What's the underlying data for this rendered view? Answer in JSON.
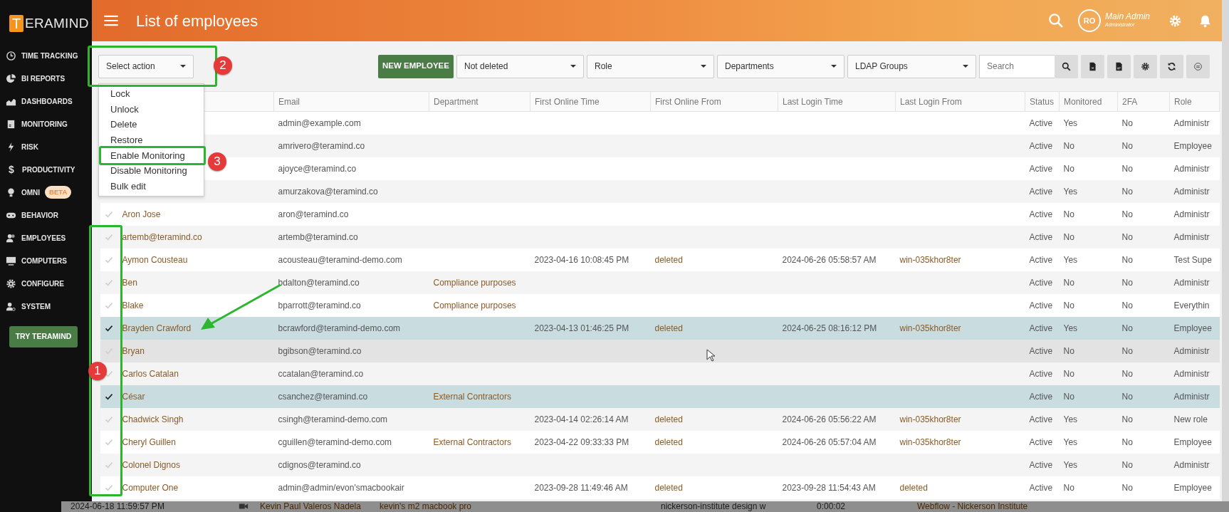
{
  "sidebar": {
    "logo": {
      "mark": "T",
      "text": "ERAMIND"
    },
    "items": [
      {
        "label": "TIME TRACKING"
      },
      {
        "label": "BI REPORTS"
      },
      {
        "label": "DASHBOARDS"
      },
      {
        "label": "MONITORING"
      },
      {
        "label": "RISK"
      },
      {
        "label": "PRODUCTIVITY",
        "glyph": "$"
      },
      {
        "label": "OMNI",
        "badge": "BETA"
      },
      {
        "label": "BEHAVIOR"
      },
      {
        "label": "EMPLOYEES"
      },
      {
        "label": "COMPUTERS"
      },
      {
        "label": "CONFIGURE"
      },
      {
        "label": "SYSTEM"
      }
    ],
    "try_button": "TRY TERAMIND"
  },
  "header": {
    "title": "List of employees",
    "avatar": "RO",
    "user_name": "Main Admin",
    "user_role": "Administrator"
  },
  "toolbar": {
    "action_select": "Select action",
    "new_button": "NEW EMPLOYEE",
    "filters": [
      {
        "label": "Not deleted"
      },
      {
        "label": "Role"
      },
      {
        "label": "Departments"
      },
      {
        "label": "LDAP Groups"
      }
    ],
    "search": {
      "placeholder": "Search"
    }
  },
  "action_menu": {
    "items": [
      {
        "label": "Lock",
        "highlighted": false
      },
      {
        "label": "Unlock",
        "highlighted": false
      },
      {
        "label": "Delete",
        "highlighted": false
      },
      {
        "label": "Restore",
        "highlighted": false
      },
      {
        "label": "Enable Monitoring",
        "highlighted": true
      },
      {
        "label": "Disable Monitoring",
        "highlighted": false
      },
      {
        "label": "Bulk edit",
        "highlighted": false
      }
    ]
  },
  "table": {
    "columns": [
      "Email",
      "Department",
      "First Online Time",
      "First Online From",
      "Last Login Time",
      "Last Login From",
      "Status",
      "Monitored",
      "2FA",
      "Role"
    ],
    "rows": [
      {
        "email": "admin@example.com",
        "status": "Active",
        "monitored": "Yes",
        "twofa": "No",
        "role": "Administr"
      },
      {
        "email": "amrivero@teramind.co",
        "status": "Active",
        "monitored": "No",
        "twofa": "No",
        "role": "Employee"
      },
      {
        "email": "ajoyce@teramind.co",
        "status": "Active",
        "monitored": "No",
        "twofa": "No",
        "role": "Administr"
      },
      {
        "email": "amurzakova@teramind.co",
        "status": "Active",
        "monitored": "Yes",
        "twofa": "No",
        "role": "Administr"
      },
      {
        "checked": false,
        "hovered": false,
        "name": "Aron Jose",
        "email": "aron@teramind.co",
        "status": "Active",
        "monitored": "No",
        "twofa": "No",
        "role": "Administr"
      },
      {
        "checked": false,
        "hovered": false,
        "name": "artemb@teramind.co",
        "email": "artemb@teramind.co",
        "status": "Active",
        "monitored": "No",
        "twofa": "No",
        "role": "Administr"
      },
      {
        "checked": false,
        "hovered": false,
        "name": "Aymon Cousteau",
        "email": "acousteau@teramind-demo.com",
        "first_online_time": "2023-04-16 10:08:45 PM",
        "first_online_from": "deleted",
        "last_login_time": "2024-06-26 05:58:57 AM",
        "last_login_from": "win-035khor8ter",
        "status": "Active",
        "monitored": "Yes",
        "twofa": "No",
        "role": "Test Supe"
      },
      {
        "checked": false,
        "hovered": false,
        "name": "Ben",
        "email": "bdalton@teramind.co",
        "department": "Compliance purposes",
        "status": "Active",
        "monitored": "No",
        "twofa": "No",
        "role": "Administr"
      },
      {
        "checked": false,
        "hovered": false,
        "name": "Blake",
        "email": "bparrott@teramind.co",
        "department": "Compliance purposes",
        "status": "Active",
        "monitored": "No",
        "twofa": "No",
        "role": "Everythin"
      },
      {
        "checked": true,
        "hovered": false,
        "name": "Brayden Crawford",
        "email": "bcrawford@teramind-demo.com",
        "first_online_time": "2023-04-13 01:46:25 PM",
        "first_online_from": "deleted",
        "last_login_time": "2024-06-25 08:16:12 PM",
        "last_login_from": "win-035khor8ter",
        "status": "Active",
        "monitored": "Yes",
        "twofa": "No",
        "role": "Employee"
      },
      {
        "checked": false,
        "hovered": true,
        "name": "Bryan",
        "email": "bgibson@teramind.co",
        "status": "Active",
        "monitored": "No",
        "twofa": "No",
        "role": "Administr"
      },
      {
        "checked": false,
        "hovered": false,
        "name": "Carlos Catalan",
        "email": "ccatalan@teramind.co",
        "status": "Active",
        "monitored": "No",
        "twofa": "No",
        "role": "Administr"
      },
      {
        "checked": true,
        "hovered": false,
        "name": "César",
        "email": "csanchez@teramind.co",
        "department": "External Contractors",
        "status": "Active",
        "monitored": "No",
        "twofa": "No",
        "role": "Administr"
      },
      {
        "checked": false,
        "hovered": false,
        "name": "Chadwick Singh",
        "email": "csingh@teramind-demo.com",
        "first_online_time": "2023-04-14 02:26:14 AM",
        "first_online_from": "deleted",
        "last_login_time": "2024-06-26 05:56:22 AM",
        "last_login_from": "win-035khor8ter",
        "status": "Active",
        "monitored": "Yes",
        "twofa": "No",
        "role": "New role"
      },
      {
        "checked": false,
        "hovered": false,
        "name": "Cheryl Guillen",
        "email": "cguillen@teramind-demo.com",
        "department": "External Contractors",
        "first_online_time": "2023-04-22 09:33:33 PM",
        "first_online_from": "deleted",
        "last_login_time": "2024-06-26 05:57:04 AM",
        "last_login_from": "win-035khor8ter",
        "status": "Active",
        "monitored": "Yes",
        "twofa": "No",
        "role": "Employee"
      },
      {
        "checked": false,
        "hovered": false,
        "name": "Colonel Dignos",
        "email": "cdignos@teramind.co",
        "status": "Active",
        "monitored": "Yes",
        "twofa": "No",
        "role": "Administr"
      },
      {
        "checked": false,
        "hovered": false,
        "name": "Computer One",
        "email": "admin@admin/evon'smacbookair",
        "first_online_time": "2023-09-28 11:49:46 AM",
        "first_online_from": "deleted",
        "last_login_time": "2023-09-28 11:54:43 AM",
        "last_login_from": "deleted",
        "status": "Active",
        "monitored": "No",
        "twofa": "No",
        "role": "Employee"
      }
    ]
  },
  "annotations": [
    {
      "number": "2",
      "kind": "badge"
    },
    {
      "number": "3",
      "kind": "badge"
    },
    {
      "number": "1",
      "kind": "badge"
    }
  ],
  "background_row": [
    "2024-06-18 11:59:57 PM",
    "Kevin Paul Valeros Nadela",
    "kevin's m2 macbook pro",
    "nickerson-institute design w",
    "0:00:02",
    "Webflow - Nickerson Institute"
  ]
}
